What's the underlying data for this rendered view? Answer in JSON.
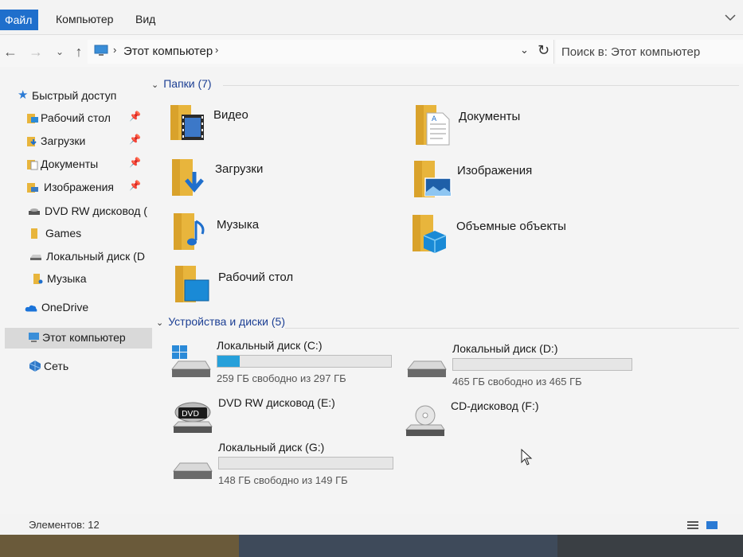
{
  "ribbon": {
    "tabs": [
      "Файл",
      "Компьютер",
      "Вид"
    ]
  },
  "address": {
    "path": "Этот компьютер",
    "search_placeholder": "Поиск в: Этот компьютер"
  },
  "nav": {
    "quick_access": "Быстрый доступ",
    "items": [
      {
        "label": "Рабочий стол",
        "pinned": true
      },
      {
        "label": "Загрузки",
        "pinned": true
      },
      {
        "label": "Документы",
        "pinned": true
      },
      {
        "label": "Изображения",
        "pinned": true
      },
      {
        "label": "DVD RW дисковод (",
        "pinned": false
      },
      {
        "label": "Games",
        "pinned": false
      },
      {
        "label": "Локальный диск (D",
        "pinned": false
      },
      {
        "label": "Музыка",
        "pinned": false
      }
    ],
    "onedrive": "OneDrive",
    "this_pc": "Этот компьютер",
    "network": "Сеть"
  },
  "folders_group": {
    "title": "Папки (7)",
    "items": [
      "Видео",
      "Документы",
      "Загрузки",
      "Изображения",
      "Музыка",
      "Объемные объекты",
      "Рабочий стол"
    ]
  },
  "drives_group": {
    "title": "Устройства и диски (5)",
    "items": [
      {
        "name": "Локальный диск (C:)",
        "free": "259 ГБ свободно из 297 ГБ",
        "used_fraction": 0.13
      },
      {
        "name": "Локальный диск (D:)",
        "free": "465 ГБ свободно из 465 ГБ",
        "used_fraction": 0.0
      },
      {
        "name": "DVD RW дисковод (E:)",
        "free": "",
        "used_fraction": null
      },
      {
        "name": "CD-дисковод (F:)",
        "free": "",
        "used_fraction": null
      },
      {
        "name": "Локальный диск (G:)",
        "free": "148 ГБ свободно из 149 ГБ",
        "used_fraction": 0.0
      }
    ]
  },
  "status": {
    "items_count": "Элементов: 12"
  },
  "colors": {
    "accent": "#1f6fcc",
    "folder": "#e8b53c",
    "usage_bar": "#26a0da",
    "group_header": "#1c3f94"
  }
}
